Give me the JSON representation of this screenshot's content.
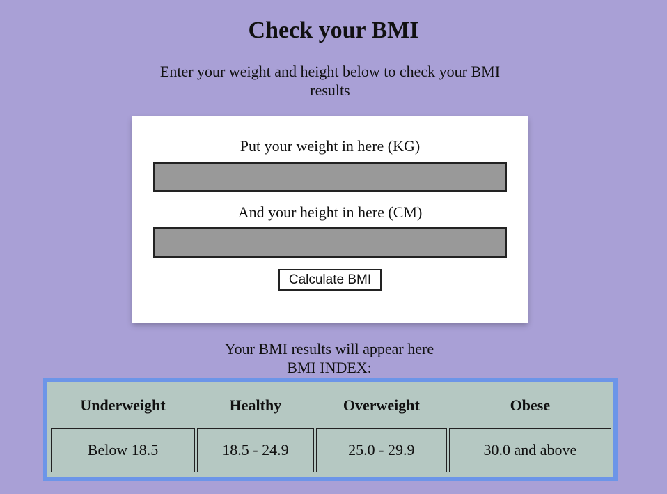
{
  "header": {
    "title": "Check your BMI",
    "intro": "Enter your weight and height below to check your BMI results"
  },
  "form": {
    "weight_label": "Put your weight in here (KG)",
    "weight_value": "",
    "height_label": "And your height in here (CM)",
    "height_value": "",
    "calculate_label": "Calculate BMI"
  },
  "results": {
    "placeholder": "Your BMI results will appear here",
    "index_label": "BMI INDEX:"
  },
  "bmi_index": {
    "columns": [
      "Underweight",
      "Healthy",
      "Overweight",
      "Obese"
    ],
    "ranges": [
      "Below 18.5",
      "18.5 - 24.9",
      "25.0 - 29.9",
      "30.0 and above"
    ]
  },
  "colors": {
    "page_background": "#a9a0d6",
    "table_border": "#6c95e8",
    "table_background": "#b5c8c2",
    "input_background": "#999999"
  }
}
